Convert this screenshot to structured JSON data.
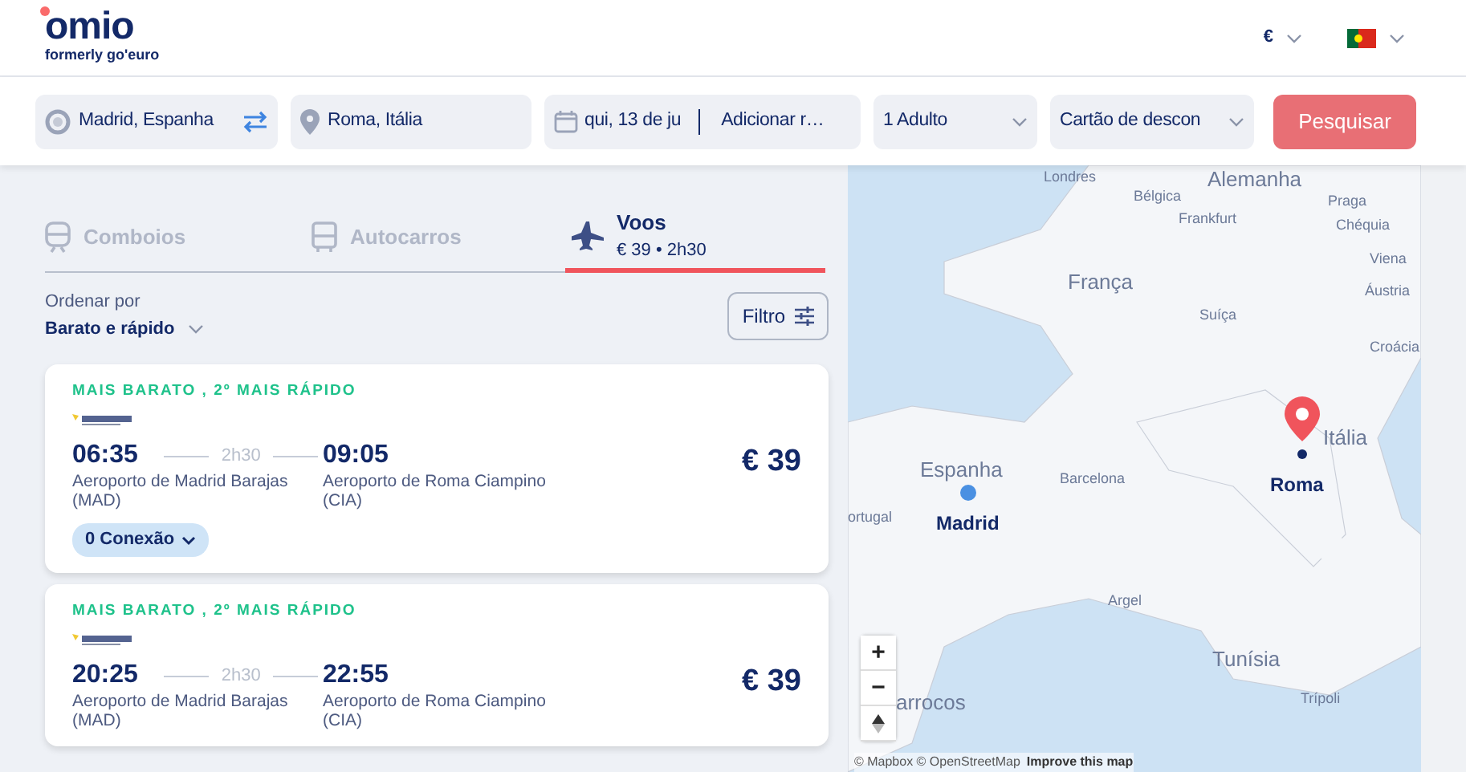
{
  "header": {
    "logo": {
      "name": "omio",
      "subtitle": "formerly go'euro"
    },
    "currency": "€"
  },
  "search": {
    "origin": "Madrid, Espanha",
    "destination": "Roma, Itália",
    "date": "qui, 13 de ju",
    "return": "Adicionar r…",
    "passengers": "1 Adulto",
    "discount": "Cartão de descon",
    "button": {
      "label": "Pesquisar",
      "disabled": true
    }
  },
  "tabs": [
    {
      "kind": "train",
      "label": "Comboios",
      "selected": false
    },
    {
      "kind": "bus",
      "label": "Autocarros",
      "selected": false
    },
    {
      "kind": "plane",
      "label": "Voos",
      "subtitle": "€ 39 • 2h30",
      "selected": true
    }
  ],
  "sort": {
    "label": "Ordenar por",
    "value": "Barato e rápido"
  },
  "filter": "Filtro",
  "results": [
    {
      "tags": "MAIS BARATO , 2º MAIS RÁPIDO",
      "depart": "06:35",
      "duration": "2h30",
      "arrive": "09:05",
      "from": "Aeroporto de Madrid Barajas (MAD)",
      "to": "Aeroporto de Roma Ciampino (CIA)",
      "price": "€ 39",
      "stops": "0 Conexão"
    },
    {
      "tags": "MAIS BARATO , 2º MAIS RÁPIDO",
      "depart": "20:25",
      "duration": "2h30",
      "arrive": "22:55",
      "from": "Aeroporto de Madrid Barajas (MAD)",
      "to": "Aeroporto de Roma Ciampino (CIA)",
      "price": "€ 39"
    }
  ],
  "map": {
    "labels": [
      "Londres",
      "Alemanha",
      "Bélgica",
      "Frankfurt",
      "Praga",
      "Chéquia",
      "Viena",
      "França",
      "Áustria",
      "Suíça",
      "Croácia",
      "Itália",
      "Espanha",
      "ortugal",
      "Barcelona",
      "Argel",
      "Tunísia",
      "Trípoli",
      "arrocos"
    ],
    "markers": [
      {
        "kind": "origin",
        "label": "Madrid"
      },
      {
        "kind": "destination",
        "label": "Roma"
      }
    ],
    "zoom_in": "+",
    "zoom_out": "−",
    "attribution": "© Mapbox © OpenStreetMap",
    "improve_link": "Improve this map"
  }
}
